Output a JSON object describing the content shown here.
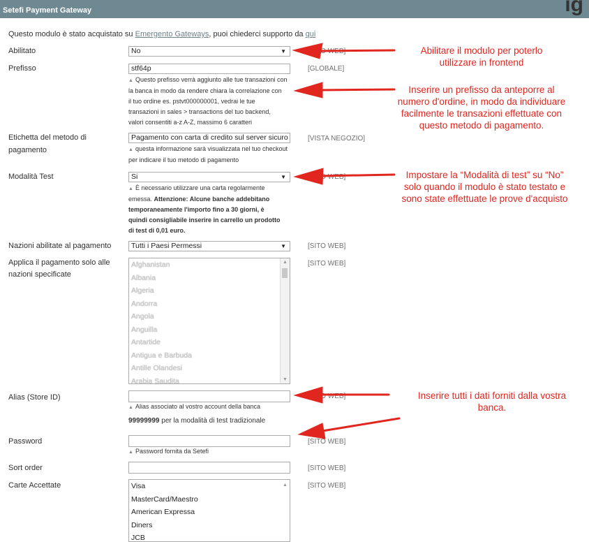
{
  "header": {
    "title": "Setefi Payment Gateway",
    "corner": "ig"
  },
  "intro": {
    "prefix": "Questo modulo è stato acquistato su",
    "link": "Emergento Gateways",
    "middle": ", puoi chiederci supporto da",
    "link2": "qui"
  },
  "fields": {
    "enabled": {
      "label": "Abilitato",
      "value": "No",
      "scope": "[SITO WEB]"
    },
    "prefix": {
      "label": "Prefisso",
      "value": "stf64p",
      "scope": "[GLOBALE]",
      "note": [
        "Questo prefisso verrà aggiunto alle tue transazioni con",
        "la banca in modo da rendere chiara la correlazione con",
        "il tuo ordine es. pstvt000000001, vedrai le tue",
        "transazioni in sales > transactions del tuo backend,",
        "valori consentiti a-z A-Z, massimo 6 caratteri"
      ]
    },
    "method_label": {
      "label1": "Etichetta del metodo di",
      "label2": "pagamento",
      "value": "Pagamento con carta di credito sul server sicuro di",
      "scope": "[VISTA NEGOZIO]",
      "note": [
        "questa informazione sarà visualizzata nel tuo checkout",
        "per indicare il tuo metodo di pagamento"
      ]
    },
    "test_mode": {
      "label": "Modalità Test",
      "value": "Si",
      "scope": "[SITO WEB]",
      "note1": "È necessario utilizzare una carta regolarmente",
      "note2": "emessa.",
      "note_bold": [
        "Attenzione: Alcune banche addebitano",
        "temporaneamente l'importo fino a 30 giorni, è",
        "quindi consigliabile inserire in carrello un prodotto",
        "di test di 0,01 euro."
      ]
    },
    "allowed_countries": {
      "label": "Nazioni abilitate al pagamento",
      "value": "Tutti i Paesi Permessi",
      "scope": "[SITO WEB]"
    },
    "specific_countries": {
      "label1": "Applica il pagamento solo alle",
      "label2": "nazioni specificate",
      "scope": "[SITO WEB]",
      "options": [
        "Afghanistan",
        "Albania",
        "Algeria",
        "Andorra",
        "Angola",
        "Anguilla",
        "Antartide",
        "Antigua e Barbuda",
        "Antille Olandesi",
        "Arabia Saudita"
      ]
    },
    "alias": {
      "label": "Alias (Store ID)",
      "value": "",
      "scope": "[SITO WEB]",
      "note": "Alias associato al vostro account della banca",
      "note2_bold": "99999999",
      "note2": " per la modalità di test tradizionale"
    },
    "password": {
      "label": "Password",
      "value": "",
      "scope": "[SITO WEB]",
      "note": "Password fornita da Setefi"
    },
    "sort_order": {
      "label": "Sort order",
      "value": "",
      "scope": "[SITO WEB]"
    },
    "cards": {
      "label": "Carte Accettate",
      "scope": "[SITO WEB]",
      "options": [
        "Visa",
        "MasterCard/Maestro",
        "American Expressa",
        "Diners",
        "JCB"
      ]
    }
  },
  "annotations": {
    "a1": [
      "Abilitare il modulo per poterlo",
      "utilizzare in frontend"
    ],
    "a2": [
      "Inserire un prefisso da anteporre al",
      "numero d'ordine, in modo da individuare",
      "facilmente le transazioni effettuate con",
      "questo metodo di pagamento."
    ],
    "a3": [
      "Impostare la “Modalità di test” su “No”",
      "solo quando il modulo è stato testato e",
      "sono state effettuate le prove d'acquisto"
    ],
    "a4": [
      "Inserire tutti i dati forniti dalla vostra",
      "banca."
    ]
  },
  "colors": {
    "header": "#6f8992",
    "annotation": "#e0261f"
  },
  "icons": {
    "dropdown": "chevron-down-icon",
    "note": "triangle-icon"
  }
}
